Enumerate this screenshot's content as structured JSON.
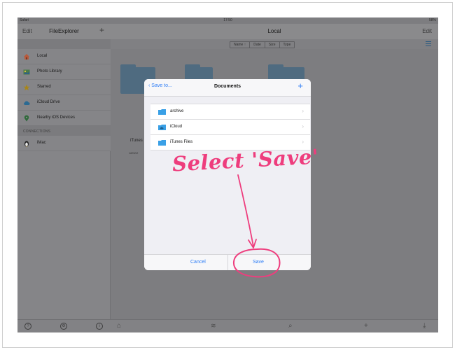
{
  "statusbar": {
    "left": "Safari",
    "time": "17:50",
    "battery": "58%"
  },
  "sidebar": {
    "edit_label": "Edit",
    "title": "FileExplorer",
    "add_icon": "plus-icon",
    "items": [
      {
        "label": "Local",
        "icon": "house-icon"
      },
      {
        "label": "Photo Library",
        "icon": "photo-library-icon"
      },
      {
        "label": "Starred",
        "icon": "star-icon"
      },
      {
        "label": "iCloud Drive",
        "icon": "cloud-icon"
      },
      {
        "label": "Nearby iOS Devices",
        "icon": "location-pin-icon"
      }
    ],
    "connections_header": "CONNECTIONS",
    "connections": [
      {
        "label": "iMac",
        "icon": "linux-penguin-icon"
      }
    ],
    "toolbar_icons": [
      "help-icon",
      "settings-gear-icon",
      "info-icon"
    ]
  },
  "main": {
    "title": "Local",
    "edit_label": "Edit",
    "sort_options": [
      "Name ↑",
      "Date",
      "Size",
      "Type"
    ],
    "background_item_label": "iTunes",
    "background_item_date": "18/02/2",
    "bottom_icons": [
      "home-icon",
      "wifi-icon",
      "search-icon",
      "plus-icon",
      "download-icon"
    ]
  },
  "dialog": {
    "back_label": "Save to...",
    "title": "Documents",
    "add_icon": "plus-icon",
    "folders": [
      {
        "name": "archive",
        "icon": "folder-icon"
      },
      {
        "name": "iCloud",
        "icon": "cloud-folder-icon"
      },
      {
        "name": "iTunes Files",
        "icon": "folder-icon"
      }
    ],
    "cancel_label": "Cancel",
    "save_label": "Save"
  },
  "annotation": {
    "text": "Select 'Save'",
    "color": "#ee3d7d"
  },
  "colors": {
    "accent": "#2f7ef6",
    "annotation": "#ee3d7d",
    "folder": "#3aa0e6"
  }
}
